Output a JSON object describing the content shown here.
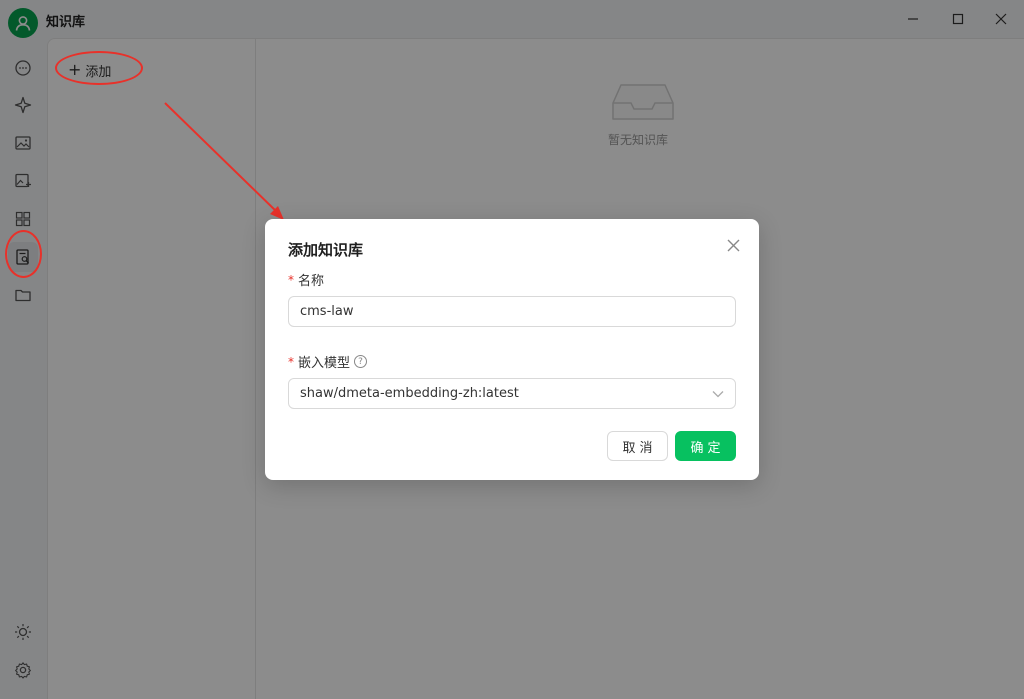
{
  "app": {
    "title": "知识库"
  },
  "list_panel": {
    "add_label": "添加"
  },
  "main": {
    "empty_text": "暂无知识库"
  },
  "modal": {
    "title": "添加知识库",
    "name_field": {
      "label": "名称",
      "required_mark": "*",
      "value": "cms-law"
    },
    "model_field": {
      "label": "嵌入模型",
      "required_mark": "*",
      "help": "?",
      "selected": "shaw/dmeta-embedding-zh:latest"
    },
    "cancel_label": "取消",
    "ok_label": "确定"
  },
  "colors": {
    "accent": "#07c160",
    "annotation": "#e8312a",
    "avatar": "#07a34f"
  },
  "icons": {
    "rail": [
      "chat-icon",
      "sparkle-icon",
      "image-icon",
      "image-edit-icon",
      "apps-grid-icon",
      "knowledge-base-icon",
      "folder-icon",
      "sun-icon",
      "settings-icon"
    ],
    "window": [
      "minimize-icon",
      "maximize-icon",
      "close-icon"
    ]
  }
}
